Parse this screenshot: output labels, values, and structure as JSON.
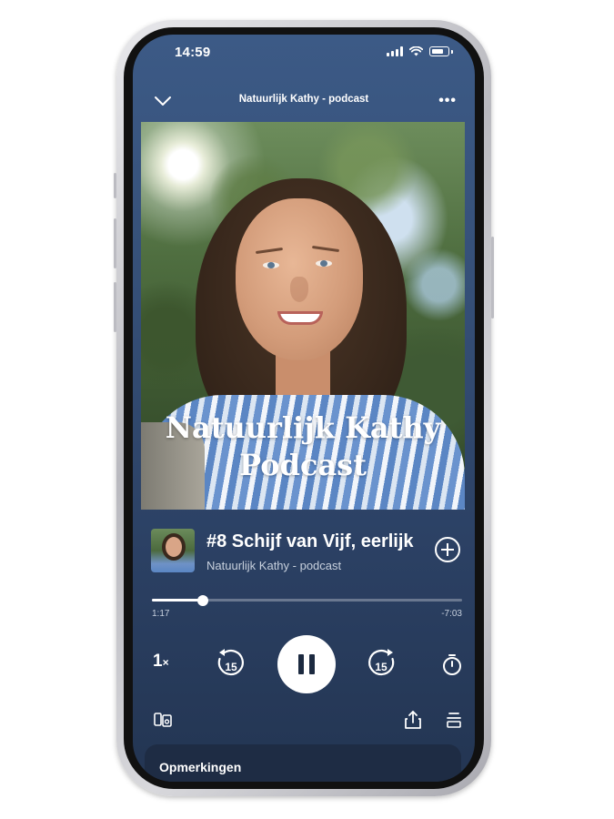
{
  "status_bar": {
    "time": "14:59"
  },
  "header": {
    "title": "Natuurlijk Kathy - podcast",
    "more_label": "•••"
  },
  "cover": {
    "title_line1": "Natuurlijk Kathy",
    "title_line2": "Podcast"
  },
  "episode": {
    "title": "#8 Schijf van Vijf, eerlijk",
    "subtitle": "Natuurlijk Kathy - podcast"
  },
  "playback": {
    "elapsed": "1:17",
    "remaining": "-7:03",
    "progress_fraction": 0.163,
    "speed_value": "1",
    "speed_suffix": "×",
    "skip_back_seconds": "15",
    "skip_forward_seconds": "15",
    "state": "playing"
  },
  "icons": {
    "collapse": "chevron-down-icon",
    "more": "more-icon",
    "add": "add-circle-icon",
    "skip_back": "skip-back-15-icon",
    "pause": "pause-icon",
    "skip_forward": "skip-forward-15-icon",
    "timer": "sleep-timer-icon",
    "devices": "connect-device-icon",
    "share": "share-icon",
    "queue": "queue-icon"
  },
  "comments": {
    "label": "Opmerkingen"
  },
  "colors": {
    "screen_bg": "#354f77",
    "comments_bg": "#1e2c44",
    "text_muted": "#c7d0dd"
  }
}
